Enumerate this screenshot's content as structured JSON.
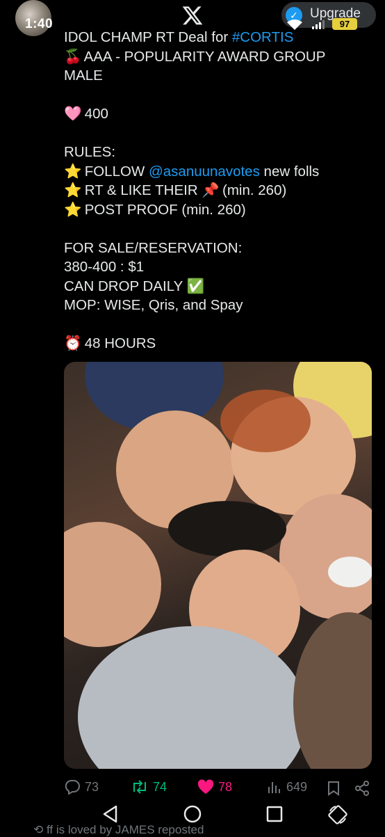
{
  "status_bar": {
    "time": "1:40",
    "battery": "97"
  },
  "header": {
    "upgrade_label": "Upgrade"
  },
  "tweet": {
    "line1_prefix": "IDOL CHAMP RT Deal for ",
    "line1_hashtag": "#CORTIS",
    "line2": "AAA - POPULARITY AWARD GROUP",
    "line3": "MALE",
    "price": "400",
    "rules_header": "RULES:",
    "rule1_prefix": "FOLLOW ",
    "rule1_mention": "@asanuunavotes",
    "rule1_suffix": " new folls",
    "rule2_prefix": "RT & LIKE THEIR ",
    "rule2_suffix": " (min. 260)",
    "rule3": "POST PROOF (min. 260)",
    "sale_header": "FOR SALE/RESERVATION:",
    "sale_price": "380-400 : $1",
    "drop_label": "CAN DROP DAILY",
    "mop": "MOP: WISE, Qris, and Spay",
    "duration": "48 HOURS"
  },
  "actions": {
    "replies": "73",
    "reposts": "74",
    "likes": "78",
    "views": "649"
  },
  "colors": {
    "background": "#000000",
    "text": "#e7e9ea",
    "link": "#1d9bf0",
    "repost": "#00ba7c",
    "like": "#f91880",
    "muted": "#71767b"
  },
  "peek": {
    "text": "ff is loved by JAMES reposted"
  }
}
